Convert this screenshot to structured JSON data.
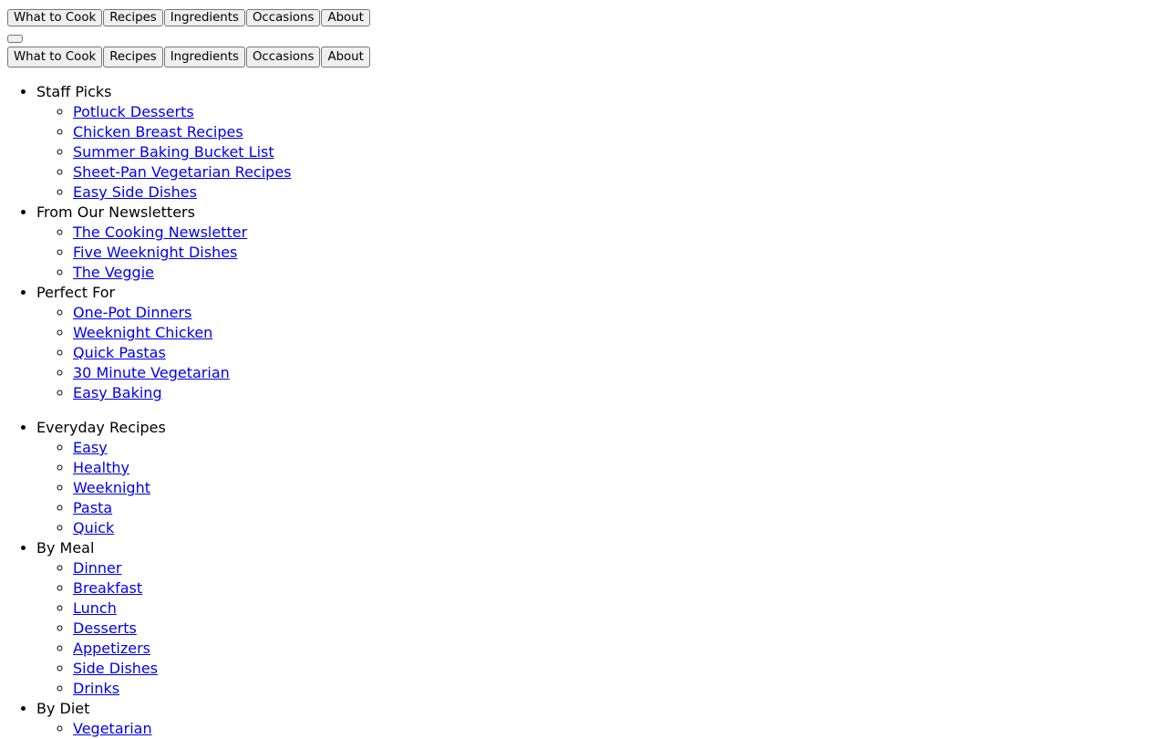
{
  "nav": {
    "primary_row": [
      {
        "label": "What to Cook"
      },
      {
        "label": "Recipes"
      },
      {
        "label": "Ingredients"
      },
      {
        "label": "Occasions"
      },
      {
        "label": "About"
      }
    ],
    "toggle": {
      "label": ""
    },
    "secondary_row": [
      {
        "label": "What to Cook"
      },
      {
        "label": "Recipes"
      },
      {
        "label": "Ingredients"
      },
      {
        "label": "Occasions"
      },
      {
        "label": "About"
      }
    ]
  },
  "colors": {
    "link": "#0000EE",
    "text": "#000000",
    "button_background": "#efefef",
    "button_border": "#767676",
    "page_background": "#ffffff"
  },
  "menu_primary": {
    "groups": [
      {
        "label": "Staff Picks",
        "items": [
          "Potluck Desserts",
          "Chicken Breast Recipes",
          "Summer Baking Bucket List",
          "Sheet-Pan Vegetarian Recipes",
          "Easy Side Dishes"
        ]
      },
      {
        "label": "From Our Newsletters",
        "items": [
          "The Cooking Newsletter",
          "Five Weeknight Dishes",
          "The Veggie"
        ]
      },
      {
        "label": "Perfect For",
        "items": [
          "One-Pot Dinners",
          "Weeknight Chicken",
          "Quick Pastas",
          "30 Minute Vegetarian",
          "Easy Baking"
        ]
      }
    ]
  },
  "menu_secondary": {
    "groups": [
      {
        "label": "Everyday Recipes",
        "items": [
          "Easy",
          "Healthy",
          "Weeknight",
          "Pasta",
          "Quick"
        ]
      },
      {
        "label": "By Meal",
        "items": [
          "Dinner",
          "Breakfast",
          "Lunch",
          "Desserts",
          "Appetizers",
          "Side Dishes",
          "Drinks"
        ]
      },
      {
        "label": "By Diet",
        "items": [
          "Vegetarian"
        ]
      }
    ]
  }
}
